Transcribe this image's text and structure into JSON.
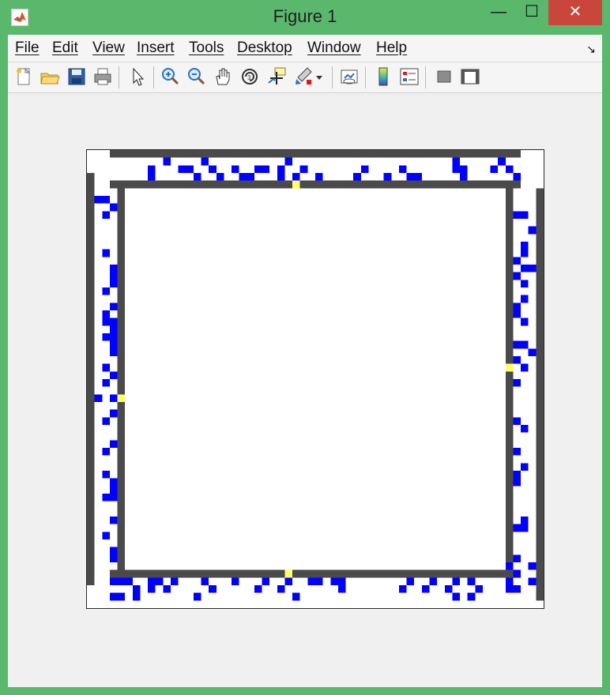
{
  "window": {
    "title": "Figure 1"
  },
  "controls": {
    "minimize": "—",
    "maximize": "☐",
    "close": "✕"
  },
  "menu": [
    {
      "label": "File",
      "name": "menu-file"
    },
    {
      "label": "Edit",
      "name": "menu-edit"
    },
    {
      "label": "View",
      "name": "menu-view"
    },
    {
      "label": "Insert",
      "name": "menu-insert"
    },
    {
      "label": "Tools",
      "name": "menu-tools"
    },
    {
      "label": "Desktop",
      "name": "menu-desktop"
    },
    {
      "label": "Window",
      "name": "menu-window"
    },
    {
      "label": "Help",
      "name": "menu-help"
    }
  ],
  "toolbar_icons": [
    "new-figure-icon",
    "open-file-icon",
    "save-icon",
    "print-icon",
    "edit-plot-arrow-icon",
    "zoom-in-icon",
    "zoom-out-icon",
    "pan-hand-icon",
    "rotate-3d-icon",
    "data-cursor-icon",
    "brush-icon",
    "brush-dropdown-icon",
    "link-plot-icon",
    "insert-colorbar-icon",
    "insert-legend-icon",
    "hide-plot-tools-icon",
    "show-plot-tools-icon"
  ],
  "colors": {
    "wall": "#4a4a4a",
    "marker": "#0000ff",
    "gate": "#ffff66",
    "background": "#ffffff"
  },
  "grid_image": {
    "cells": 60,
    "walls": [
      [
        3,
        0,
        54,
        1
      ],
      [
        3,
        60,
        54,
        1
      ],
      [
        0,
        3,
        1,
        54
      ],
      [
        59,
        5,
        1,
        54
      ],
      [
        3,
        4,
        54,
        1
      ],
      [
        3,
        55,
        53,
        1
      ],
      [
        4,
        5,
        1,
        51
      ],
      [
        55,
        4,
        1,
        51
      ]
    ],
    "gates": [
      [
        27,
        4
      ],
      [
        4,
        32
      ],
      [
        55,
        28
      ],
      [
        26,
        55
      ]
    ],
    "markers": [
      [
        10,
        1
      ],
      [
        15,
        1
      ],
      [
        26,
        1
      ],
      [
        48,
        1
      ],
      [
        54,
        1
      ],
      [
        8,
        2
      ],
      [
        12,
        2
      ],
      [
        13,
        2
      ],
      [
        16,
        2
      ],
      [
        19,
        2
      ],
      [
        22,
        2
      ],
      [
        23,
        2
      ],
      [
        25,
        2
      ],
      [
        28,
        2
      ],
      [
        36,
        2
      ],
      [
        41,
        2
      ],
      [
        48,
        2
      ],
      [
        49,
        2
      ],
      [
        53,
        2
      ],
      [
        55,
        2
      ],
      [
        8,
        3
      ],
      [
        14,
        3
      ],
      [
        17,
        3
      ],
      [
        20,
        3
      ],
      [
        21,
        3
      ],
      [
        25,
        3
      ],
      [
        27,
        3
      ],
      [
        30,
        3
      ],
      [
        35,
        3
      ],
      [
        39,
        3
      ],
      [
        42,
        3
      ],
      [
        43,
        3
      ],
      [
        49,
        3
      ],
      [
        56,
        3
      ],
      [
        1,
        6
      ],
      [
        2,
        6
      ],
      [
        3,
        7
      ],
      [
        2,
        8
      ],
      [
        56,
        8
      ],
      [
        57,
        8
      ],
      [
        58,
        10
      ],
      [
        57,
        12
      ],
      [
        2,
        13
      ],
      [
        57,
        13
      ],
      [
        56,
        14
      ],
      [
        3,
        15
      ],
      [
        57,
        15
      ],
      [
        3,
        16
      ],
      [
        58,
        15
      ],
      [
        56,
        16
      ],
      [
        3,
        17
      ],
      [
        2,
        18
      ],
      [
        57,
        17
      ],
      [
        3,
        20
      ],
      [
        57,
        19
      ],
      [
        3,
        20
      ],
      [
        56,
        20
      ],
      [
        2,
        21
      ],
      [
        3,
        22
      ],
      [
        56,
        21
      ],
      [
        2,
        22
      ],
      [
        57,
        22
      ],
      [
        3,
        23
      ],
      [
        2,
        24
      ],
      [
        3,
        24
      ],
      [
        56,
        25
      ],
      [
        57,
        25
      ],
      [
        3,
        25
      ],
      [
        3,
        26
      ],
      [
        58,
        26
      ],
      [
        2,
        28
      ],
      [
        57,
        28
      ],
      [
        3,
        29
      ],
      [
        56,
        27
      ],
      [
        2,
        30
      ],
      [
        56,
        30
      ],
      [
        1,
        32
      ],
      [
        3,
        32
      ],
      [
        3,
        34
      ],
      [
        2,
        35
      ],
      [
        56,
        35
      ],
      [
        57,
        36
      ],
      [
        3,
        38
      ],
      [
        2,
        39
      ],
      [
        56,
        39
      ],
      [
        57,
        41
      ],
      [
        2,
        42
      ],
      [
        3,
        43
      ],
      [
        56,
        43
      ],
      [
        3,
        44
      ],
      [
        56,
        42
      ],
      [
        2,
        45
      ],
      [
        3,
        45
      ],
      [
        3,
        48
      ],
      [
        56,
        49
      ],
      [
        57,
        49
      ],
      [
        57,
        48
      ],
      [
        2,
        50
      ],
      [
        3,
        52
      ],
      [
        56,
        53
      ],
      [
        55,
        54
      ],
      [
        58,
        54
      ],
      [
        3,
        53
      ],
      [
        56,
        55
      ],
      [
        3,
        56
      ],
      [
        4,
        56
      ],
      [
        5,
        56
      ],
      [
        8,
        56
      ],
      [
        9,
        56
      ],
      [
        11,
        56
      ],
      [
        15,
        56
      ],
      [
        19,
        56
      ],
      [
        23,
        56
      ],
      [
        26,
        56
      ],
      [
        29,
        56
      ],
      [
        30,
        56
      ],
      [
        32,
        56
      ],
      [
        33,
        56
      ],
      [
        42,
        56
      ],
      [
        45,
        56
      ],
      [
        48,
        56
      ],
      [
        50,
        56
      ],
      [
        55,
        56
      ],
      [
        58,
        56
      ],
      [
        6,
        57
      ],
      [
        8,
        57
      ],
      [
        10,
        57
      ],
      [
        16,
        57
      ],
      [
        22,
        57
      ],
      [
        25,
        57
      ],
      [
        33,
        57
      ],
      [
        41,
        57
      ],
      [
        44,
        57
      ],
      [
        47,
        57
      ],
      [
        51,
        57
      ],
      [
        55,
        57
      ],
      [
        56,
        57
      ],
      [
        3,
        58
      ],
      [
        4,
        58
      ],
      [
        6,
        58
      ],
      [
        14,
        58
      ],
      [
        27,
        58
      ],
      [
        48,
        58
      ],
      [
        50,
        58
      ]
    ]
  }
}
